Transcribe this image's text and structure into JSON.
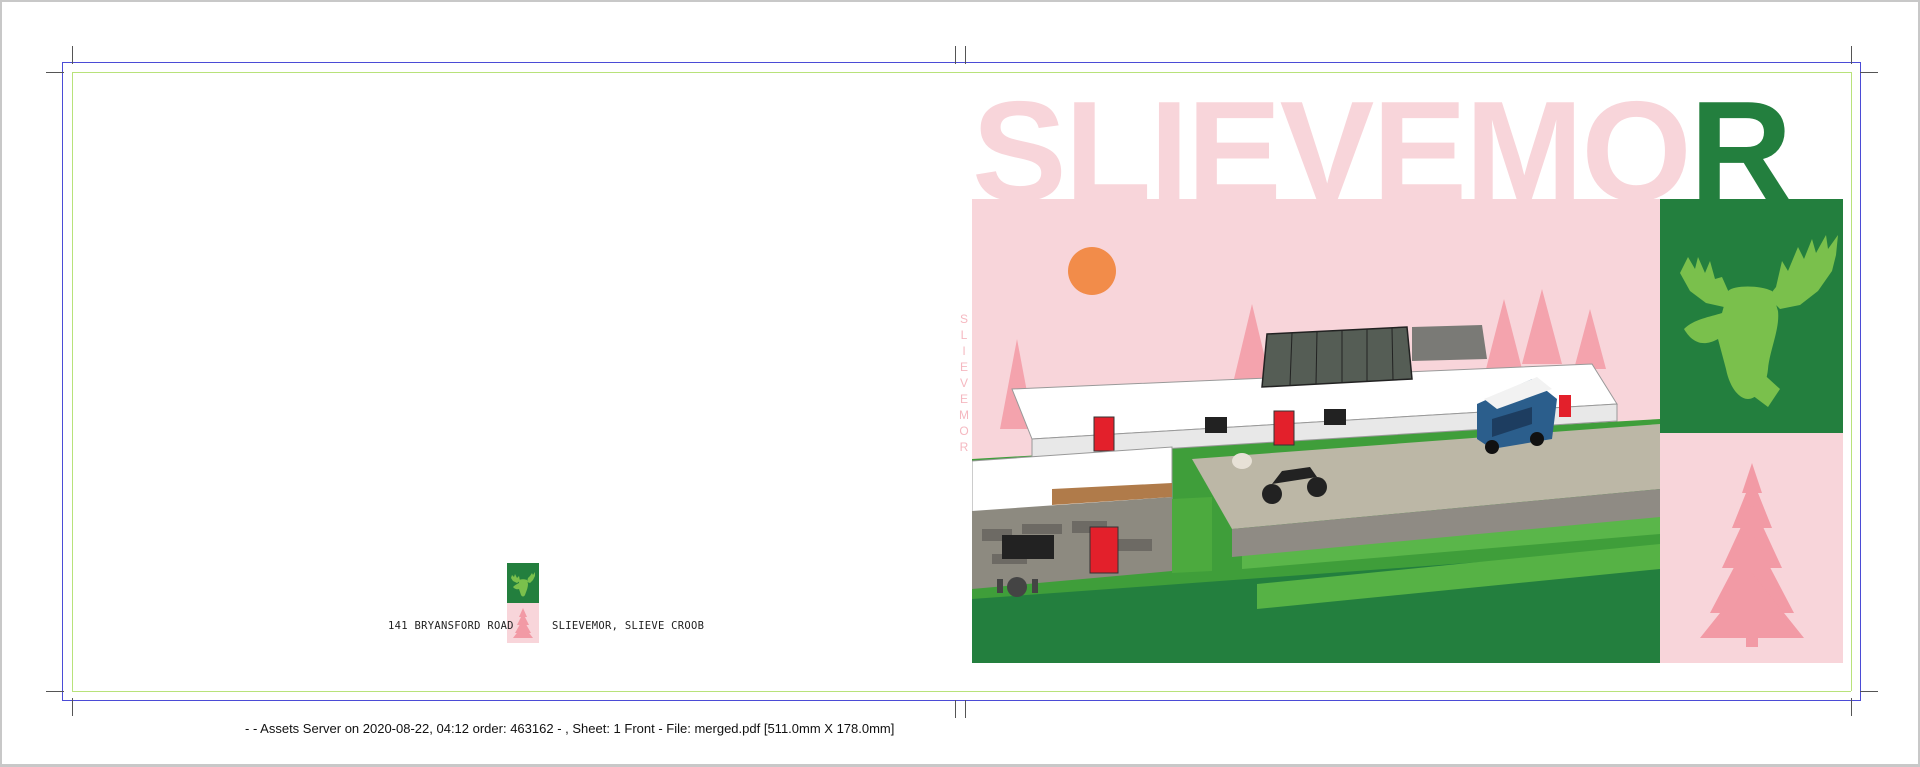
{
  "cover": {
    "title_faint": "SLIEVEMO",
    "title_strong": "R",
    "spine_text": "SLIEVEMOR"
  },
  "back": {
    "address_left": "141 BRYANSFORD ROAD",
    "address_right": "SLIEVEMOR, SLIEVE CROOB"
  },
  "slug_line": "- - Assets Server on 2020-08-22, 04:12 order: 463162 - , Sheet: 1 Front - File: merged.pdf [511.0mm X 178.0mm]",
  "colors": {
    "brand_green": "#237f3e",
    "light_green": "#7ac04c",
    "brand_pink": "#f8d5da",
    "tree_pink": "#f29aa5",
    "sun_orange": "#f28c4a",
    "bleed_line": "#4b4bd6",
    "trim_line": "#b8e27a"
  },
  "icons": [
    "moose-head-icon",
    "pine-tree-icon"
  ]
}
